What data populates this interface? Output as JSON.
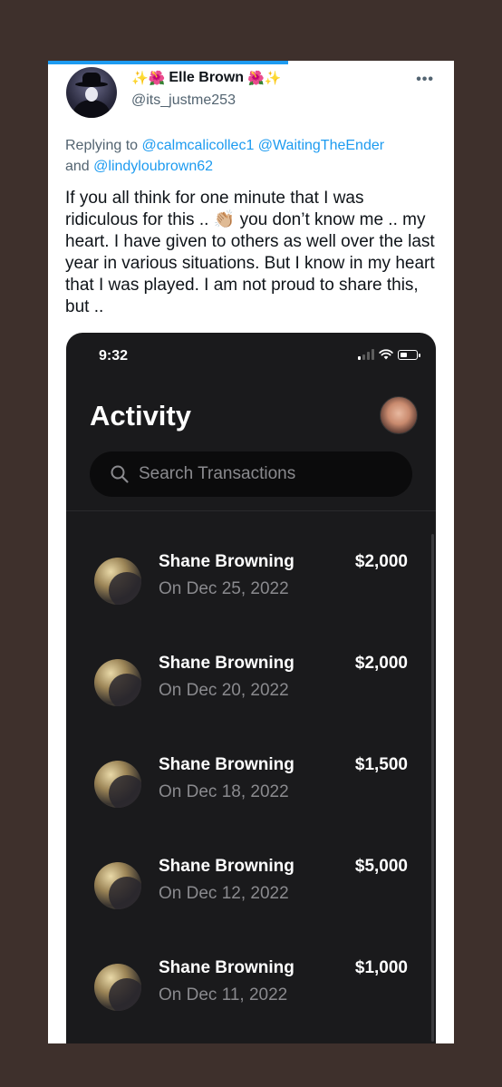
{
  "tweet": {
    "emoji_left": "✨🌺",
    "author_name": "Elle Brown",
    "emoji_right": "🌺✨",
    "handle": "@its_justme253",
    "more_label": "•••",
    "replying_prefix": "Replying to ",
    "mentions": [
      "@calmcalicollec1",
      "@WaitingTheEnder",
      "@lindyloubrown62"
    ],
    "mentions_and": "and ",
    "text": "If you all think for one minute that I was ridiculous for this .. 👏🏼 you don’t know me .. my heart.  I have given to others as well over the last year in various situations.   But I know in my heart that I was played.  I am not proud to share this, but .."
  },
  "phone": {
    "status_time": "9:32",
    "title": "Activity",
    "search_placeholder": "Search Transactions",
    "transactions": [
      {
        "name": "Shane Browning",
        "date": "On Dec 25, 2022",
        "amount": "$2,000"
      },
      {
        "name": "Shane Browning",
        "date": "On Dec 20, 2022",
        "amount": "$2,000"
      },
      {
        "name": "Shane Browning",
        "date": "On Dec 18, 2022",
        "amount": "$1,500"
      },
      {
        "name": "Shane Browning",
        "date": "On Dec 12, 2022",
        "amount": "$5,000"
      },
      {
        "name": "Shane Browning",
        "date": "On Dec 11, 2022",
        "amount": "$1,000"
      }
    ]
  },
  "colors": {
    "background": "#3e302c",
    "accent": "#1d9bf0",
    "phone_bg": "#1a1a1c"
  },
  "icons": {
    "more": "more-icon",
    "search": "search-icon",
    "signal": "signal-icon",
    "wifi": "wifi-icon",
    "battery": "battery-icon"
  }
}
